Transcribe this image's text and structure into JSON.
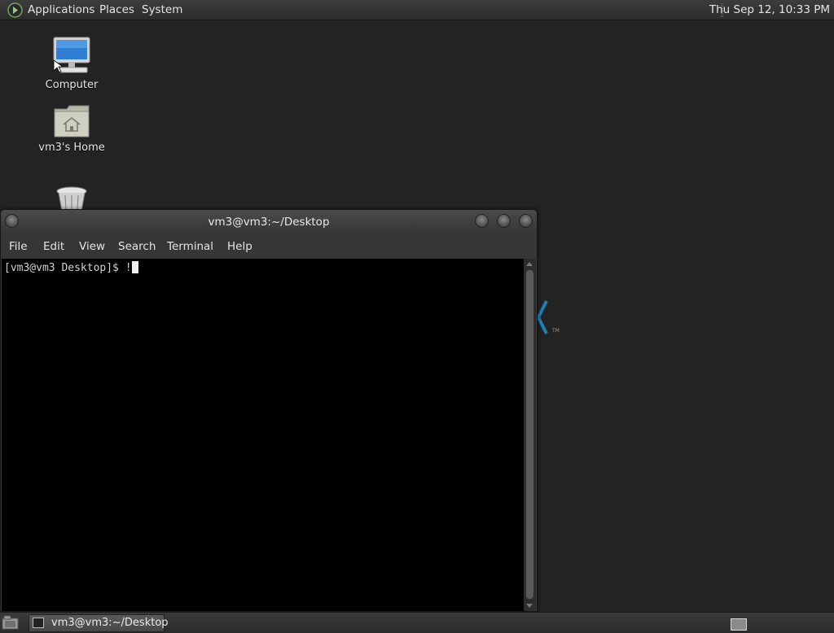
{
  "top_panel": {
    "menus": [
      "Applications",
      "Places",
      "System"
    ],
    "clock": "Thu Sep 12, 10:33 PM"
  },
  "desktop": {
    "icons": [
      {
        "label": "Computer",
        "icon": "computer-icon"
      },
      {
        "label": "vm3's Home",
        "icon": "home-folder-icon"
      },
      {
        "label": "",
        "icon": "trash-icon"
      }
    ]
  },
  "terminal": {
    "title": "vm3@vm3:~/Desktop",
    "menu": [
      "File",
      "Edit",
      "View",
      "Search",
      "Terminal",
      "Help"
    ],
    "prompt_line": "[vm3@vm3 Desktop]$ !"
  },
  "bottom_panel": {
    "task_label": "vm3@vm3:~/Desktop"
  },
  "colors": {
    "panel_bg": "#2c2c2c",
    "desktop_bg": "#232323",
    "terminal_bg": "#000000",
    "accent_logo": "#1f7fb8"
  }
}
